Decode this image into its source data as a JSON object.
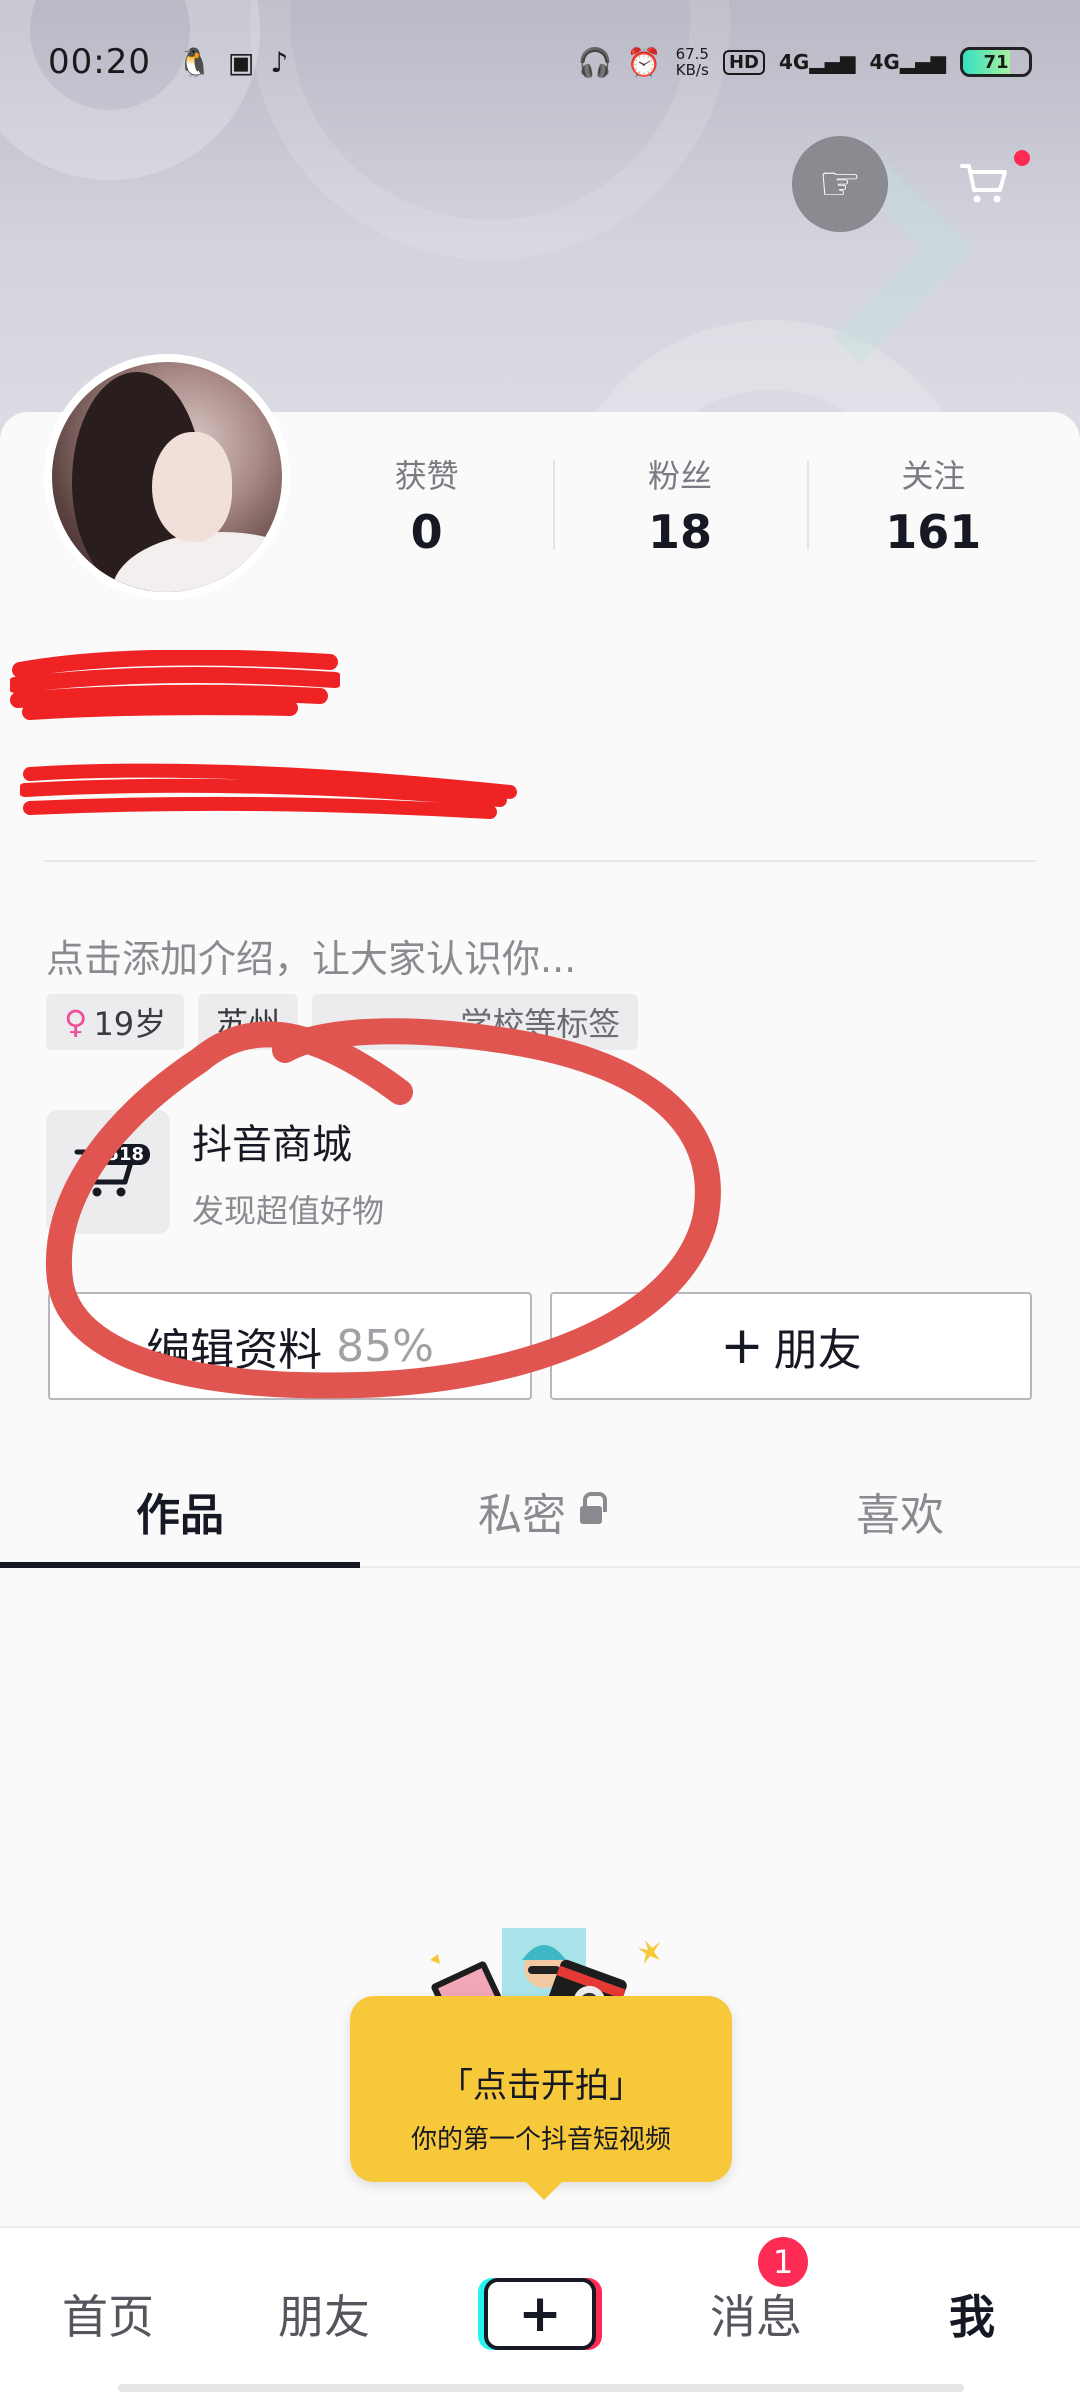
{
  "status_bar": {
    "time": "00:20",
    "net_speed_value": "67.5",
    "net_speed_unit": "KB/s",
    "hd_label": "HD",
    "signal_1": "4G",
    "signal_2": "4G",
    "battery": "71",
    "battery_level": 0.71,
    "left_icons": [
      "qq-icon",
      "pay-icon",
      "douyin-icon"
    ],
    "right_icons": [
      "headphone-icon",
      "alarm-icon"
    ]
  },
  "header": {
    "share_icon": "pointing-hand-icon",
    "cart_icon": "shopping-cart-icon",
    "cart_has_dot": true
  },
  "profile": {
    "stats": [
      {
        "label": "获赞",
        "value": "0"
      },
      {
        "label": "粉丝",
        "value": "18"
      },
      {
        "label": "关注",
        "value": "161"
      }
    ],
    "intro_placeholder": "点击添加介绍，让大家认识你...",
    "tags": {
      "age": "19岁",
      "city": "苏州",
      "school": "学校等标签"
    }
  },
  "mall": {
    "badge": "518",
    "title": "抖音商城",
    "subtitle": "发现超值好物"
  },
  "buttons": {
    "edit_label": "编辑资料",
    "edit_percent": "85%",
    "add_friend_label": "朋友",
    "add_friend_plus": "+"
  },
  "tabs": [
    {
      "label": "作品",
      "active": true
    },
    {
      "label": "私密",
      "active": false,
      "icon": "lock-icon"
    },
    {
      "label": "喜欢",
      "active": false
    }
  ],
  "shoot_prompt": {
    "title": "「点击开拍」",
    "subtitle": "你的第一个抖音短视频"
  },
  "bottom_nav": {
    "items": [
      "首页",
      "朋友",
      "消息",
      "我"
    ],
    "add_label": "+",
    "message_badge": "1",
    "active": "我"
  },
  "colors": {
    "accent_red": "#fe2c55",
    "accent_cyan": "#25f4ee",
    "bubble_yellow": "#f7c93a",
    "annotation_red": "#e0554f"
  }
}
